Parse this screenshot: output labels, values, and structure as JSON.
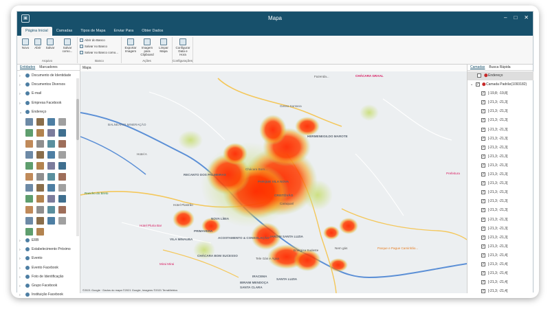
{
  "window": {
    "title": "Mapa",
    "controls": [
      "–",
      "□",
      "✕"
    ]
  },
  "tabs": [
    "Página Inicial",
    "Camadas",
    "Tipos de Mapa",
    "Enviar Para",
    "Obter Dados"
  ],
  "ribbon": {
    "arquivo": {
      "label": "Arquivo",
      "buttons": [
        "Novo",
        "Abrir",
        "Salvar",
        "Salvar como..."
      ]
    },
    "banco": {
      "label": "Banco",
      "rows": [
        "Abrir do Banco",
        "Salvar no Banco",
        "Salvar no Banco como..."
      ]
    },
    "acoes": {
      "label": "Ações",
      "buttons": [
        "Exportar Imagem",
        "Imagem para Clipboard",
        "Limpar Mapa"
      ]
    },
    "config": {
      "label": "Configurações",
      "buttons": [
        "Configurar Data e Hora"
      ]
    }
  },
  "left_panel": {
    "tabs": [
      "Entidades",
      "Marcadores"
    ],
    "items_top": [
      "Documento de Identidade",
      "Documentos Diversos",
      "E-mail",
      "Empresa Facebook",
      "Endereço"
    ],
    "items_bottom": [
      "ERB",
      "Estabelecimento Próximo",
      "Evento",
      "Evento Facebook",
      "Foto de Identificação",
      "Grupo Facebook",
      "Instituição Facebook"
    ]
  },
  "map": {
    "header": "Mapa",
    "attribution": "©2021 Google · Dados do mapa ©2021 Google, Imagens ©2021 TerraMetrics",
    "labels": [
      "BALNEARIO MINERAÇÃO",
      "Rancho do Breto",
      "Hotel A",
      "Gesso Santana",
      "HERMENEGILDO MAROTE",
      "Chácara Bom...",
      "RECANTO DOS PALMEIRAS",
      "PARQUE VILA NOVA",
      "Hotel Plastrão",
      "CRISTÓVÃO",
      "Caraquarí",
      "VILA MINAUBA",
      "PRIMAVERA",
      "NOVA LÍBIA",
      "ACOSTAMENTO & CONSOLAÇÃO",
      "JARDIM SANTA LUZIA",
      "SANTA LUZIA",
      "CHÁCARA BOM SUCESSO",
      "Mirai Mirai",
      "Tele Gás e Água",
      "Energisa Sudeste",
      "Nem gás",
      "IRACEMA",
      "SANTA CLARA",
      "IBRAIM MENDOÇA",
      "Parque e Pague Caminhão...",
      "CHÁCARA GRAAL",
      "Fazenda...",
      "Hotel Pluria Bar",
      "Prefeitura"
    ]
  },
  "right_panel": {
    "tabs": [
      "Camadas",
      "Busca Rápida"
    ],
    "root": "Endereço",
    "layer": "Camada Padrão(1093182)",
    "items": [
      "[-19,8; -19,8]",
      "[-21,3; -21,3]",
      "[-21,3; -21,3]",
      "[-21,3; -21,3]",
      "[-21,3; -21,3]",
      "[-21,3; -21,3]",
      "[-21,3; -21,3]",
      "[-21,3; -21,3]",
      "[-21,3; -21,3]",
      "[-21,3; -21,3]",
      "[-21,3; -21,3]",
      "[-21,3; -21,3]",
      "[-21,3; -21,3]",
      "[-21,3; -21,3]",
      "[-21,3; -21,3]",
      "[-21,3; -21,3]",
      "[-21,3; -21,3]",
      "[-21,3; -21,3]",
      "[-21,3; -21,4]",
      "[-21,3; -21,4]",
      "[-21,3; -21,4]",
      "[-21,3; -21,4]",
      "[-21,3; -21,4]"
    ]
  },
  "colors": {
    "accent": "#17506b",
    "heat_core": "#ff2a00",
    "heat_edge": "#b8d56a",
    "road": "#f4c75a",
    "river": "#5b8fd6"
  }
}
